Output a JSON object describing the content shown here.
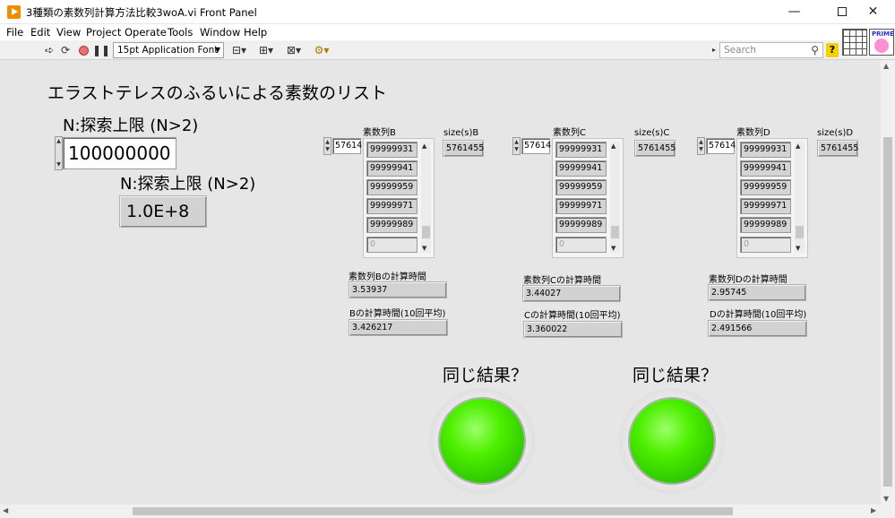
{
  "window": {
    "title": "3種類の素数列計算方法比較3woA.vi Front Panel",
    "minimize": "—",
    "close": "✕"
  },
  "menu": [
    "File",
    "Edit",
    "View",
    "Project",
    "Operate",
    "Tools",
    "Window",
    "Help"
  ],
  "toolbar": {
    "font": "15pt Application Font",
    "search_placeholder": "Search",
    "help": "?",
    "prime_label": "PRIME"
  },
  "panel": {
    "title": "エラストテレスのふるいによる素数のリスト",
    "control_label": "N:探索上限 (N>2)",
    "control_value": "100000000",
    "indicator_label": "N:探索上限 (N>2)",
    "indicator_value": "1.0E+8"
  },
  "arrays": [
    {
      "label": "素数列B",
      "index": "57614",
      "items": [
        "99999931",
        "99999941",
        "99999959",
        "99999971",
        "99999989"
      ],
      "empty": "0",
      "size_label": "size(s)B",
      "size_value": "5761455",
      "time_label": "素数列Bの計算時間",
      "time_value": "3.53937",
      "avg_label": "Bの計算時間(10回平均)",
      "avg_value": "3.426217"
    },
    {
      "label": "素数列C",
      "index": "57614",
      "items": [
        "99999931",
        "99999941",
        "99999959",
        "99999971",
        "99999989"
      ],
      "empty": "0",
      "size_label": "size(s)C",
      "size_value": "5761455",
      "time_label": "素数列Cの計算時間",
      "time_value": "3.44027",
      "avg_label": "Cの計算時間(10回平均)",
      "avg_value": "3.360022"
    },
    {
      "label": "素数列D",
      "index": "57614",
      "items": [
        "99999931",
        "99999941",
        "99999959",
        "99999971",
        "99999989"
      ],
      "empty": "0",
      "size_label": "size(s)D",
      "size_value": "5761455",
      "time_label": "素数列Dの計算時間",
      "time_value": "2.95745",
      "avg_label": "Dの計算時間(10回平均)",
      "avg_value": "2.491566"
    }
  ],
  "leds": [
    {
      "label": "同じ結果？",
      "state": "on",
      "color": "#44e000"
    },
    {
      "label": "同じ結果？",
      "state": "on",
      "color": "#44e000"
    }
  ]
}
